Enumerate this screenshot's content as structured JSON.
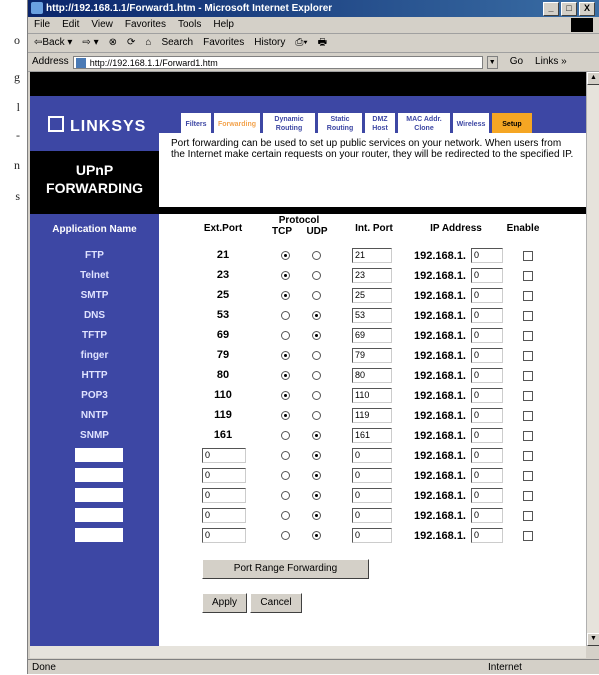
{
  "margin_letters": [
    "o",
    "g",
    "l",
    "-",
    "n",
    "s"
  ],
  "window": {
    "title": "http://192.168.1.1/Forward1.htm - Microsoft Internet Explorer",
    "controls": [
      "_",
      "□",
      "X"
    ],
    "menu": [
      "File",
      "Edit",
      "View",
      "Favorites",
      "Tools",
      "Help"
    ],
    "toolbar": [
      "⇦Back ▾",
      "⇨ ▾",
      "⊗",
      "⟳",
      "⌂",
      "Search",
      "Favorites",
      "History",
      "⎙▾",
      "🖶"
    ],
    "address_label": "Address",
    "address_value": "http://192.168.1.1/Forward1.htm",
    "go": "Go",
    "links": "Links »",
    "status_text": "Done",
    "zone": "Internet"
  },
  "router": {
    "brand": "LINKSYS",
    "tabs": [
      "Filters",
      "Forwarding",
      "Dynamic Routing",
      "Static Routing",
      "DMZ Host",
      "MAC Addr. Clone",
      "Wireless",
      "Setup"
    ],
    "active_tab": "Forwarding",
    "section_title_1": "UPnP",
    "section_title_2": "FORWARDING",
    "description": "Port forwarding can be used to set up public services on your network. When users from the Internet make certain requests on your router, they will be redirected to the specified IP.",
    "headers": {
      "app_name": "Application Name",
      "ext_port": "Ext.Port",
      "protocol": "Protocol",
      "tcp": "TCP",
      "udp": "UDP",
      "int_port": "Int. Port",
      "ip_address": "IP Address",
      "enable": "Enable"
    },
    "ip_prefix": "192.168.1.",
    "rows": [
      {
        "name": "FTP",
        "ext": "21",
        "proto": "TCP",
        "int": "21",
        "ip": "0"
      },
      {
        "name": "Telnet",
        "ext": "23",
        "proto": "TCP",
        "int": "23",
        "ip": "0"
      },
      {
        "name": "SMTP",
        "ext": "25",
        "proto": "TCP",
        "int": "25",
        "ip": "0"
      },
      {
        "name": "DNS",
        "ext": "53",
        "proto": "UDP",
        "int": "53",
        "ip": "0"
      },
      {
        "name": "TFTP",
        "ext": "69",
        "proto": "UDP",
        "int": "69",
        "ip": "0"
      },
      {
        "name": "finger",
        "ext": "79",
        "proto": "TCP",
        "int": "79",
        "ip": "0"
      },
      {
        "name": "HTTP",
        "ext": "80",
        "proto": "TCP",
        "int": "80",
        "ip": "0"
      },
      {
        "name": "POP3",
        "ext": "110",
        "proto": "TCP",
        "int": "110",
        "ip": "0"
      },
      {
        "name": "NNTP",
        "ext": "119",
        "proto": "TCP",
        "int": "119",
        "ip": "0"
      },
      {
        "name": "SNMP",
        "ext": "161",
        "proto": "UDP",
        "int": "161",
        "ip": "0"
      }
    ],
    "custom_rows": [
      {
        "ext": "0",
        "proto": "UDP",
        "int": "0",
        "ip": "0"
      },
      {
        "ext": "0",
        "proto": "UDP",
        "int": "0",
        "ip": "0"
      },
      {
        "ext": "0",
        "proto": "UDP",
        "int": "0",
        "ip": "0"
      },
      {
        "ext": "0",
        "proto": "UDP",
        "int": "0",
        "ip": "0"
      },
      {
        "ext": "0",
        "proto": "UDP",
        "int": "0",
        "ip": "0"
      }
    ],
    "port_range_button": "Port Range Forwarding",
    "apply_button": "Apply",
    "cancel_button": "Cancel"
  }
}
